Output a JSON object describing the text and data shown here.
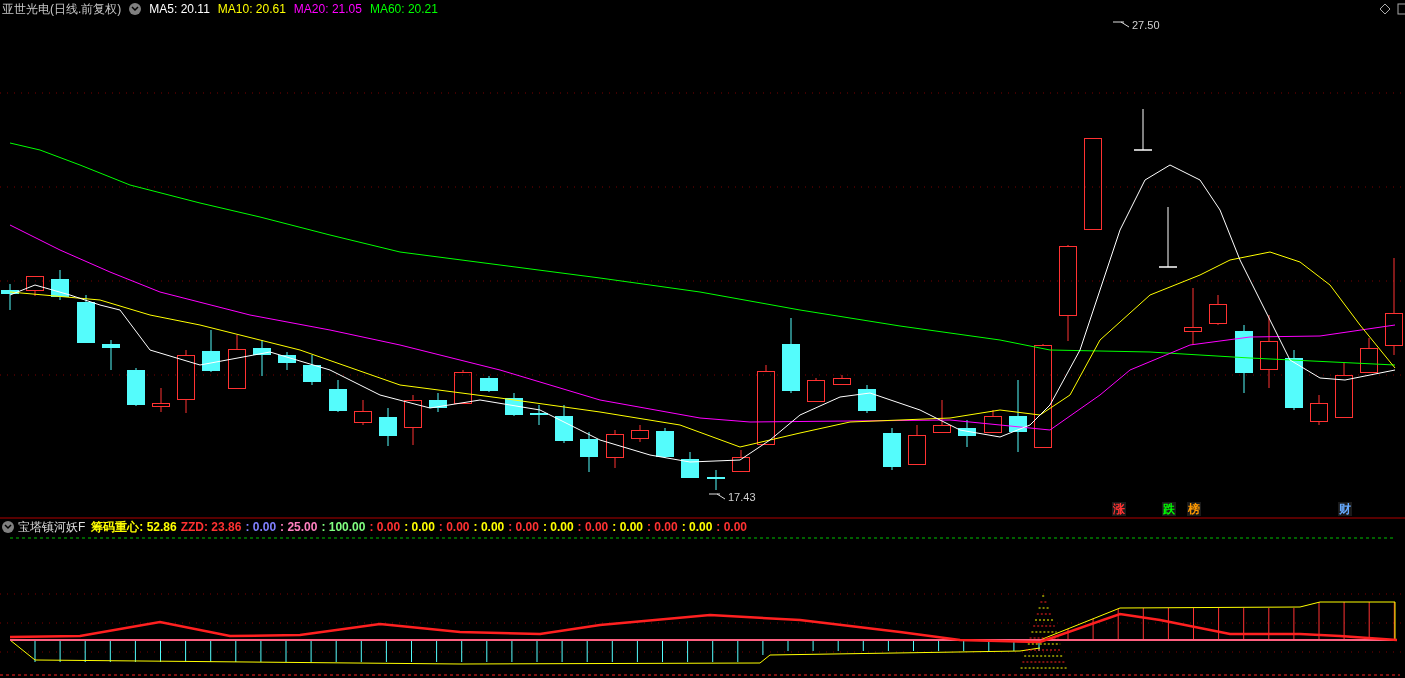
{
  "chart_header": {
    "title": "亚世光电(日线.前复权)",
    "indicators": [
      {
        "label": "MA5: 20.11",
        "color": "#ffffff"
      },
      {
        "label": "MA10: 20.61",
        "color": "#ffff00"
      },
      {
        "label": "MA20: 21.05",
        "color": "#ff00ff"
      },
      {
        "label": "MA60: 20.21",
        "color": "#00ff00"
      }
    ]
  },
  "price_labels": [
    {
      "kind": "high",
      "text": "27.50"
    },
    {
      "kind": "low",
      "text": "17.43"
    }
  ],
  "event_markers": [
    {
      "text": "涨",
      "color": "#ff3232"
    },
    {
      "text": "跌",
      "color": "#00ff00"
    },
    {
      "text": "榜",
      "color": "#ff9900"
    },
    {
      "text": "财",
      "color": "#66aaff"
    }
  ],
  "indicator_header": {
    "title": "宝塔镇河妖F",
    "values": [
      {
        "label": "筹码重心: 52.86",
        "color": "#ffff00"
      },
      {
        "label": "ZZD: 23.86",
        "color": "#ff3232"
      },
      {
        "label": ": 0.00",
        "color": "#8080ff"
      },
      {
        "label": ": 25.00",
        "color": "#ff80c0"
      },
      {
        "label": ": 100.00",
        "color": "#80ff80"
      },
      {
        "label": ": 0.00",
        "color": "#ff3232"
      },
      {
        "label": ": 0.00",
        "color": "#ffff00"
      },
      {
        "label": ": 0.00",
        "color": "#ff3232"
      },
      {
        "label": ": 0.00",
        "color": "#ffff00"
      },
      {
        "label": ": 0.00",
        "color": "#ff3232"
      },
      {
        "label": ": 0.00",
        "color": "#ffff00"
      },
      {
        "label": ": 0.00",
        "color": "#ff3232"
      },
      {
        "label": ": 0.00",
        "color": "#ffff00"
      },
      {
        "label": ": 0.00",
        "color": "#ff3232"
      },
      {
        "label": ": 0.00",
        "color": "#ffff00"
      },
      {
        "label": ": 0.00",
        "color": "#ff3232"
      }
    ]
  }
}
